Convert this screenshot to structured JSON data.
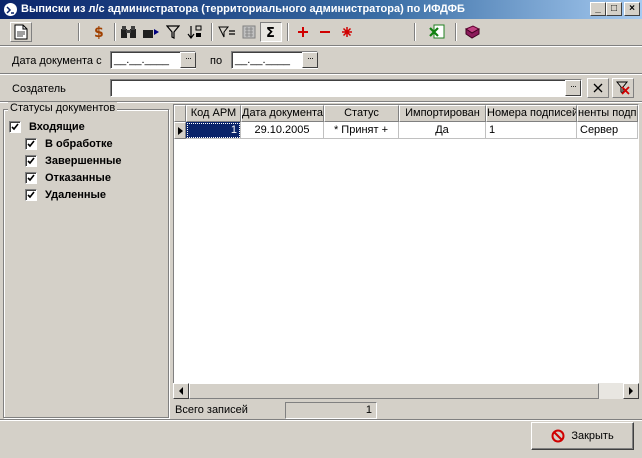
{
  "window": {
    "title": "Выписки из л/с администратора (территориального администратора) по ИФДФБ",
    "controls": [
      "_",
      "□",
      "×"
    ]
  },
  "toolbar": {
    "icons": [
      "document-icon",
      "dollar-icon",
      "binoculars-icon",
      "find-next-icon",
      "filter-icon",
      "sort-icon",
      "filter-eq-icon",
      "calculator-icon",
      "sum-icon",
      "add-icon",
      "remove-icon",
      "asterisk-icon",
      "excel-icon",
      "book-icon"
    ]
  },
  "filters": {
    "date_from_label": "Дата документа с",
    "date_from_value": "__.__.____",
    "date_to_label": "по",
    "date_to_value": "__.__.____",
    "creator_label": "Создатель",
    "creator_value": ""
  },
  "status_group": {
    "title": "Статусы документов",
    "items": [
      {
        "label": "Входящие",
        "checked": true,
        "level": 0
      },
      {
        "label": "В обработке",
        "checked": true,
        "level": 1
      },
      {
        "label": "Завершенные",
        "checked": true,
        "level": 1
      },
      {
        "label": "Отказанные",
        "checked": true,
        "level": 1
      },
      {
        "label": "Удаленные",
        "checked": true,
        "level": 1
      }
    ]
  },
  "grid": {
    "columns": [
      "Код АРМ",
      "Дата документа",
      "Статус",
      "Импортирован",
      "Номера подписей",
      "ненты подпи"
    ],
    "rows": [
      [
        "1",
        "29.10.2005",
        "* Принят +",
        "Да",
        "1",
        "Сервер"
      ]
    ]
  },
  "footer": {
    "total_label": "Всего записей",
    "total_value": "1",
    "close_label": "Закрыть"
  },
  "colors": {
    "titlebar": "#0a246a",
    "selection": "#0a246a",
    "face": "#d4d0c8"
  }
}
